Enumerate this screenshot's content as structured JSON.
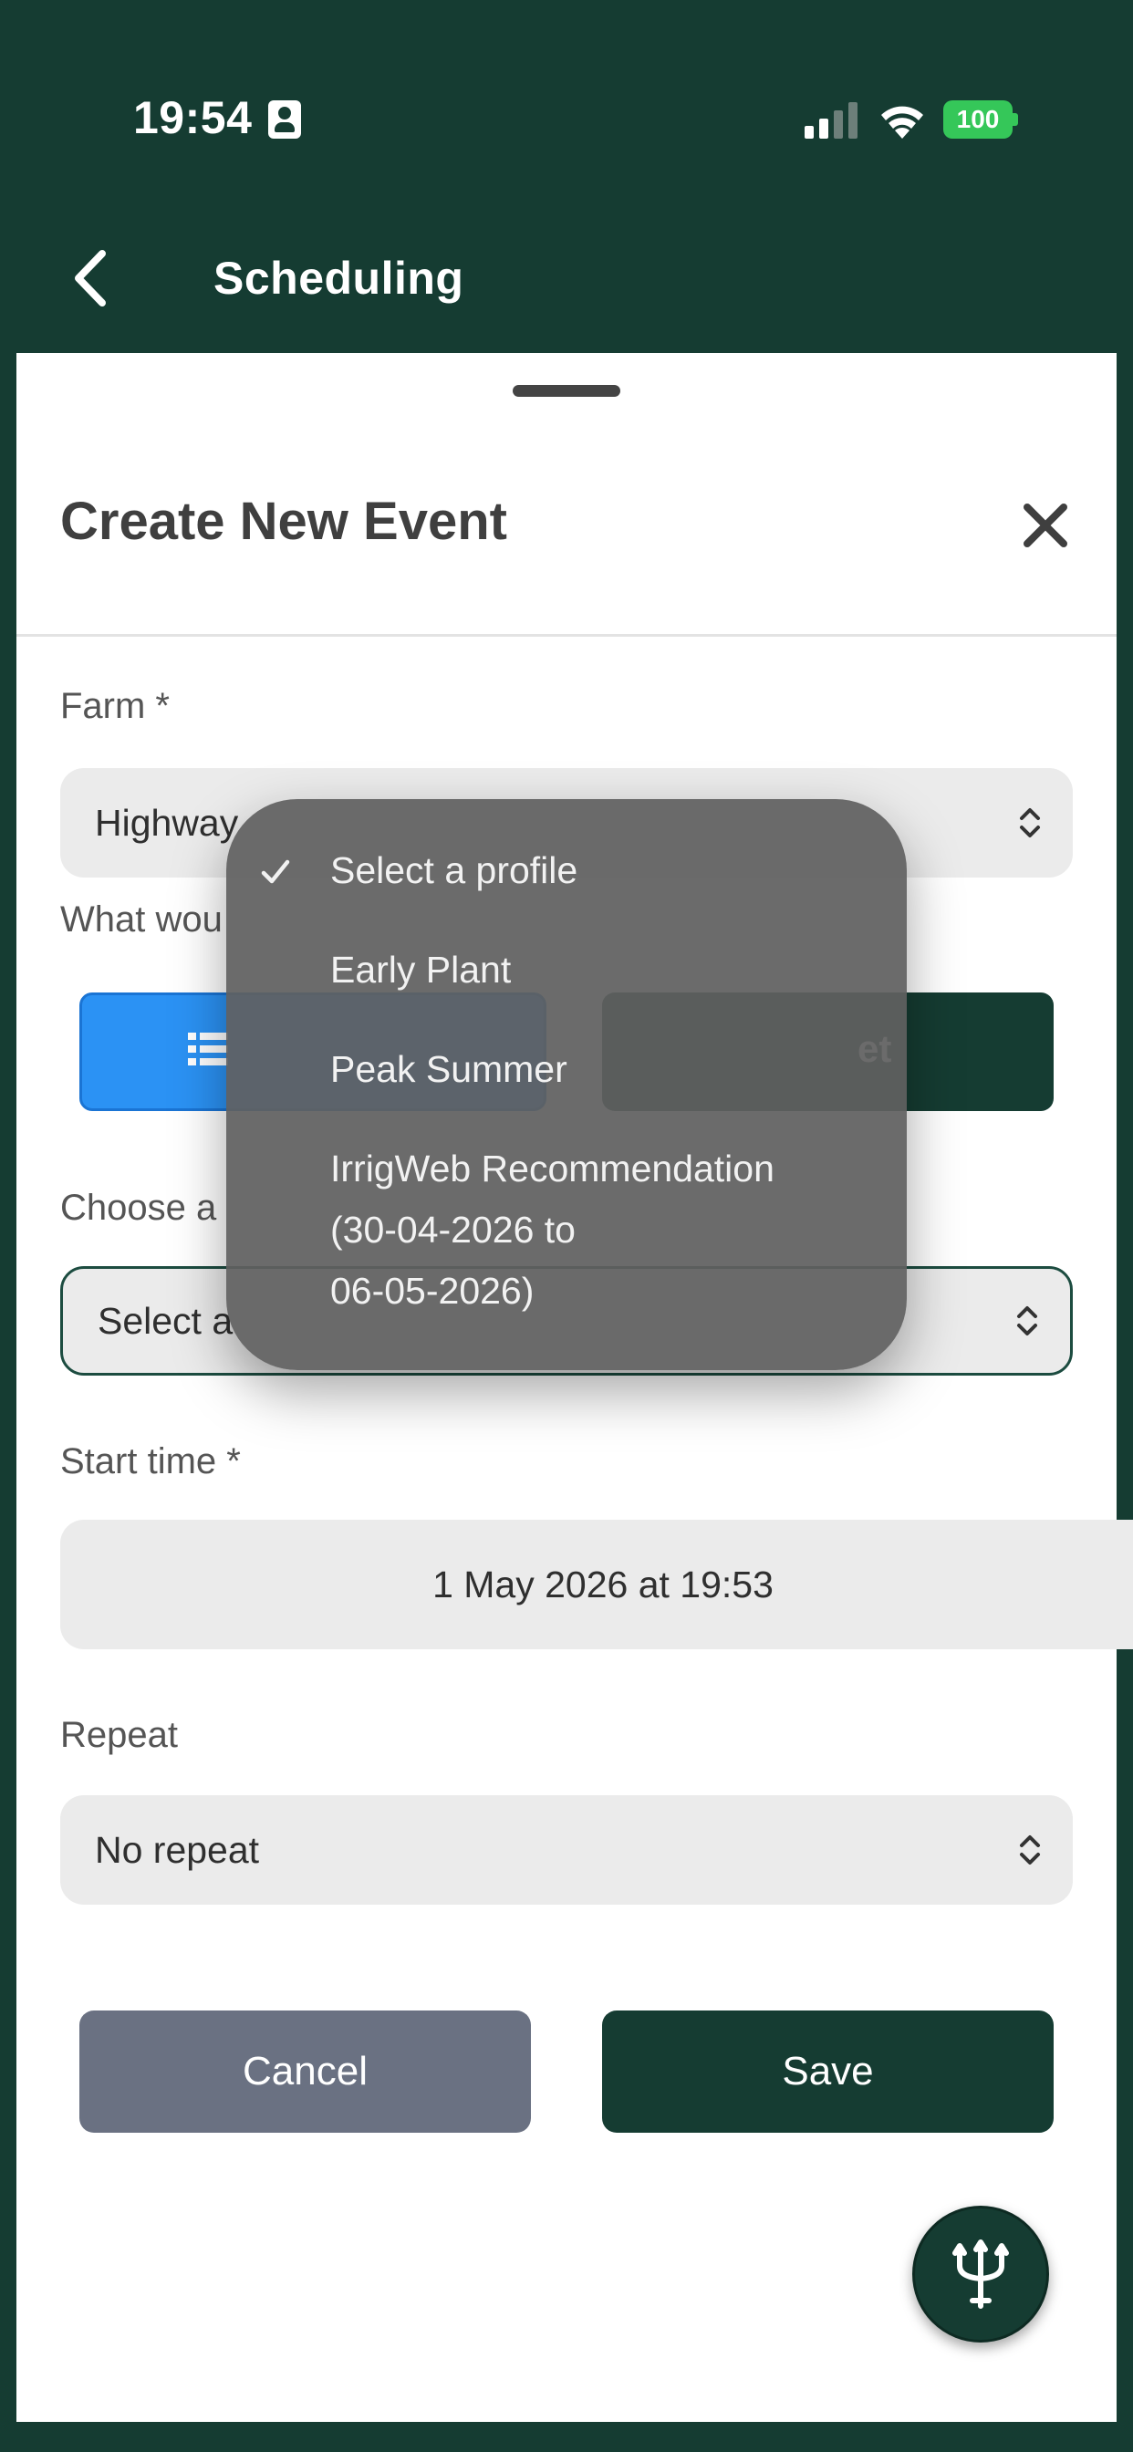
{
  "status_bar": {
    "time": "19:54",
    "battery": "100"
  },
  "nav": {
    "title": "Scheduling"
  },
  "sheet": {
    "title": "Create New Event",
    "farm": {
      "label": "Farm *",
      "value": "Highway"
    },
    "question": {
      "label": "What wou"
    },
    "segments": {
      "right_label": "et"
    },
    "choose": {
      "label": "Choose a",
      "value": "Select a"
    },
    "start_time": {
      "label": "Start time *",
      "value": "1 May 2026 at 19:53"
    },
    "repeat": {
      "label": "Repeat",
      "value": "No repeat"
    },
    "cancel_label": "Cancel",
    "save_label": "Save"
  },
  "menu": {
    "items": [
      {
        "label": "Select a profile",
        "checked": true
      },
      {
        "label": "Early Plant",
        "checked": false
      },
      {
        "label": "Peak Summer",
        "checked": false
      },
      {
        "label": "IrrigWeb Recommendation",
        "checked": false
      }
    ],
    "item3_line2": "(30-04-2026 to",
    "item3_line3": "06-05-2026)"
  },
  "colors": {
    "brand_dark": "#153c32",
    "accent_blue": "#2b92f4",
    "battery_green": "#35c759",
    "cancel_gray": "#6a7182"
  },
  "icons": [
    "id-card-icon",
    "signal-icon",
    "wifi-icon",
    "battery-icon",
    "back-chevron-icon",
    "close-icon",
    "chevron-updown-icon",
    "list-icon",
    "checkmark-icon",
    "trident-icon"
  ]
}
